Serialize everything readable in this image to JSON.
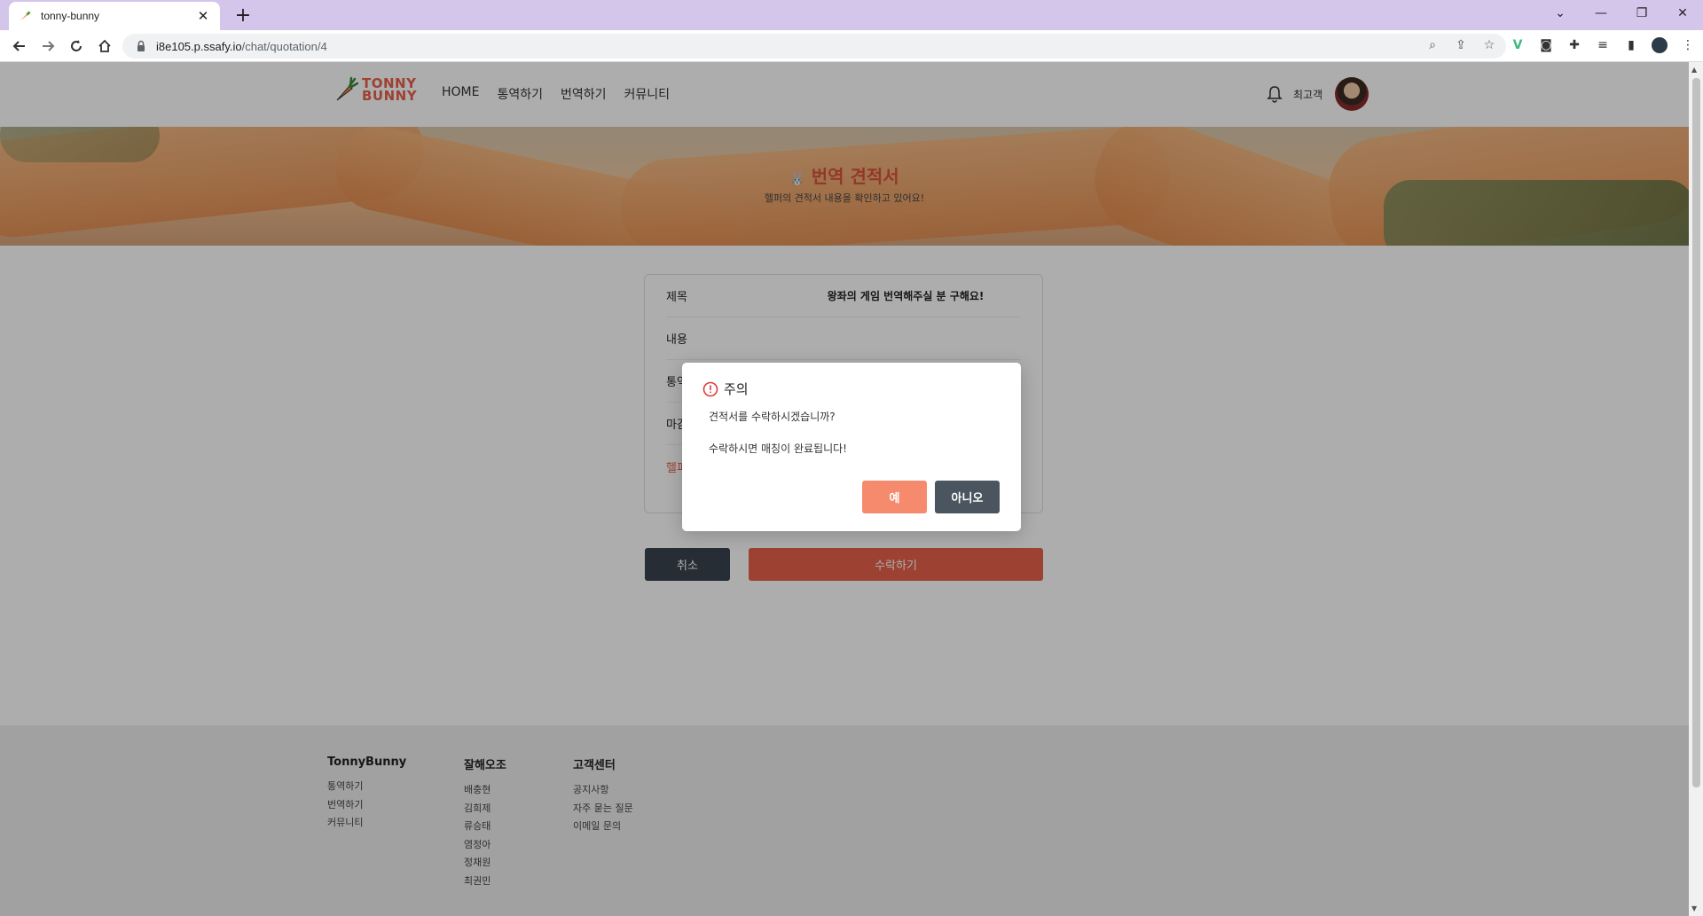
{
  "browser": {
    "tab_title": "tonny-bunny",
    "tab_close": "✕",
    "new_tab": "+",
    "url_host": "i8e105.p.ssafy.io",
    "url_path": "/chat/quotation/4",
    "window_controls": [
      "⌄",
      "—",
      "❐",
      "✕"
    ]
  },
  "site": {
    "logo_line1": "TONNY",
    "logo_line2": "BUNNY",
    "nav": [
      "HOME",
      "통역하기",
      "번역하기",
      "커뮤니티"
    ],
    "user_name": "최고객"
  },
  "banner": {
    "title": "번역 견적서",
    "subtitle": "헬퍼의 견적서 내용을 확인하고 있어요!"
  },
  "quotation": {
    "rows": [
      {
        "label": "제목",
        "value": "왕좌의 게임 번역해주실 분 구해요!"
      },
      {
        "label": "내용",
        "value": ""
      },
      {
        "label": "통역",
        "value": ""
      },
      {
        "label": "마감",
        "value": ""
      },
      {
        "label": "헬퍼",
        "value": ""
      }
    ],
    "cancel_label": "취소",
    "accept_label": "수락하기"
  },
  "footer": {
    "columns": [
      {
        "title": "TonnyBunny",
        "items": [
          "통역하기",
          "번역하기",
          "커뮤니티"
        ]
      },
      {
        "title": "잘해오조",
        "items": [
          "배충현",
          "김희제",
          "류승태",
          "염정아",
          "정채원",
          "최권민"
        ]
      },
      {
        "title": "고객센터",
        "items": [
          "공지사항",
          "자주 묻는 질문",
          "이메일 문의"
        ]
      }
    ]
  },
  "modal": {
    "title": "주의",
    "message_1": "견적서를 수락하시겠습니까?",
    "message_2": "수락하시면 매칭이 완료됩니다!",
    "yes_label": "예",
    "no_label": "아니오"
  },
  "colors": {
    "brand": "#e8604a",
    "tabbar": "#d3c6ea",
    "dark_button": "#38434e"
  }
}
